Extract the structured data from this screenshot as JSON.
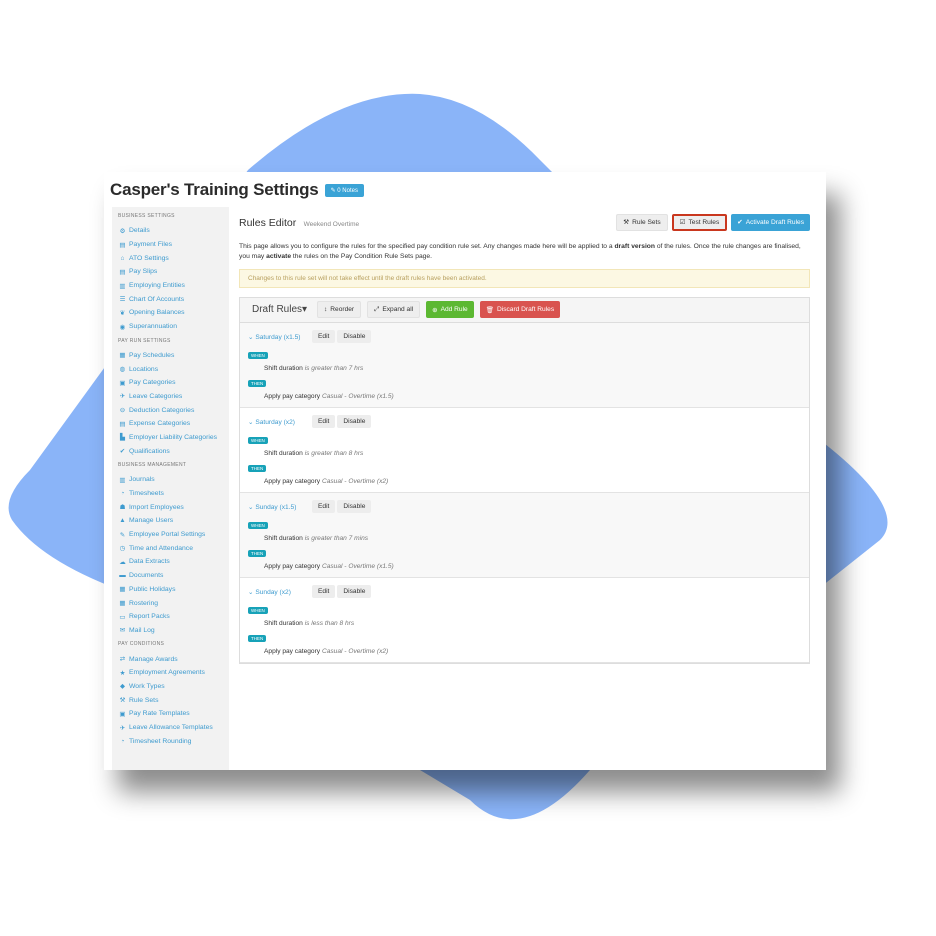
{
  "colors": {
    "blob": "#8ab4f8",
    "accent": "#3aa3d6",
    "test_rules_outline": "#c9371e",
    "add": "#5cb832",
    "discard": "#d9534f"
  },
  "page": {
    "title": "Casper's Training Settings",
    "notes_badge": "0 Notes"
  },
  "sidebar": {
    "sections": [
      {
        "heading": "BUSINESS SETTINGS",
        "items": [
          {
            "label": "Details",
            "icon": "gear-icon"
          },
          {
            "label": "Payment Files",
            "icon": "file-icon"
          },
          {
            "label": "ATO Settings",
            "icon": "bank-icon"
          },
          {
            "label": "Pay Slips",
            "icon": "document-icon"
          },
          {
            "label": "Employing Entities",
            "icon": "building-icon"
          },
          {
            "label": "Chart Of Accounts",
            "icon": "list-icon"
          },
          {
            "label": "Opening Balances",
            "icon": "leaf-icon"
          },
          {
            "label": "Superannuation",
            "icon": "lifebuoy-icon"
          }
        ]
      },
      {
        "heading": "PAY RUN SETTINGS",
        "items": [
          {
            "label": "Pay Schedules",
            "icon": "calendar-icon"
          },
          {
            "label": "Locations",
            "icon": "globe-icon"
          },
          {
            "label": "Pay Categories",
            "icon": "money-icon"
          },
          {
            "label": "Leave Categories",
            "icon": "plane-icon"
          },
          {
            "label": "Deduction Categories",
            "icon": "minus-circle-icon"
          },
          {
            "label": "Expense Categories",
            "icon": "list-alt-icon"
          },
          {
            "label": "Employer Liability Categories",
            "icon": "chart-icon"
          },
          {
            "label": "Qualifications",
            "icon": "check-icon"
          }
        ]
      },
      {
        "heading": "BUSINESS MANAGEMENT",
        "items": [
          {
            "label": "Journals",
            "icon": "columns-icon"
          },
          {
            "label": "Timesheets",
            "icon": "clock-icon"
          },
          {
            "label": "Import Employees",
            "icon": "people-icon"
          },
          {
            "label": "Manage Users",
            "icon": "lock-icon"
          },
          {
            "label": "Employee Portal Settings",
            "icon": "wrench-icon"
          },
          {
            "label": "Time and Attendance",
            "icon": "time-icon"
          },
          {
            "label": "Data Extracts",
            "icon": "cloud-download-icon"
          },
          {
            "label": "Documents",
            "icon": "folder-icon"
          },
          {
            "label": "Public Holidays",
            "icon": "calendar-icon"
          },
          {
            "label": "Rostering",
            "icon": "grid-icon"
          },
          {
            "label": "Report Packs",
            "icon": "package-icon"
          },
          {
            "label": "Mail Log",
            "icon": "envelope-icon"
          }
        ]
      },
      {
        "heading": "PAY CONDITIONS",
        "items": [
          {
            "label": "Manage Awards",
            "icon": "transfer-icon"
          },
          {
            "label": "Employment Agreements",
            "icon": "star-icon"
          },
          {
            "label": "Work Types",
            "icon": "tag-icon"
          },
          {
            "label": "Rule Sets",
            "icon": "gavel-icon"
          },
          {
            "label": "Pay Rate Templates",
            "icon": "money-icon"
          },
          {
            "label": "Leave Allowance Templates",
            "icon": "plane-icon"
          },
          {
            "label": "Timesheet Rounding",
            "icon": "clock-icon"
          }
        ]
      }
    ]
  },
  "main": {
    "title": "Rules Editor",
    "subtitle": "Weekend Overtime",
    "buttons": {
      "rule_sets": "Rule Sets",
      "test_rules": "Test Rules",
      "activate": "Activate Draft Rules"
    },
    "intro": {
      "p1": "This page allows you to configure the rules for the specified pay condition rule set. Any changes made here will be applied to a ",
      "b1": "draft version",
      "p2": " of the rules. Once the rule changes are finalised, you may ",
      "b2": "activate",
      "p3": " the rules on the Pay Condition Rule Sets page."
    },
    "alert": "Changes to this rule set will not take effect until the draft rules have been activated.",
    "toolbar": {
      "draft_rules": "Draft Rules",
      "reorder": "Reorder",
      "expand_all": "Expand all",
      "add_rule": "Add Rule",
      "discard": "Discard Draft Rules"
    },
    "rule_labels": {
      "edit": "Edit",
      "disable": "Disable",
      "when": "WHEN",
      "then": "THEN",
      "apply_prefix": "Apply pay category",
      "shift_prefix": "Shift duration"
    },
    "rules": [
      {
        "name": "Saturday (x1.5)",
        "when": "is greater than 7 hrs",
        "then": "Casual - Overtime (x1.5)"
      },
      {
        "name": "Saturday (x2)",
        "when": "is greater than 8 hrs",
        "then": "Casual - Overtime (x2)"
      },
      {
        "name": "Sunday (x1.5)",
        "when": "is greater than 7 mins",
        "then": "Casual - Overtime (x1.5)"
      },
      {
        "name": "Sunday (x2)",
        "when": "is less than 8 hrs",
        "then": "Casual - Overtime (x2)"
      }
    ]
  }
}
